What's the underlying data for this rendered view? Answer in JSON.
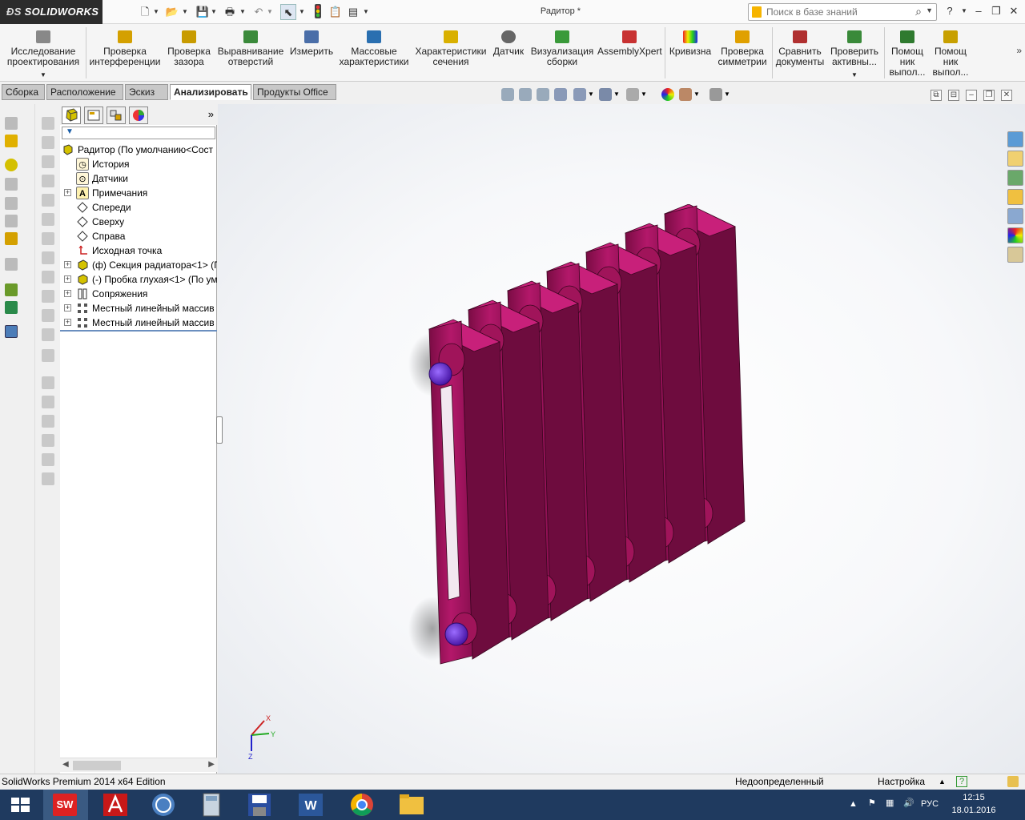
{
  "titlebar": {
    "app_name": "SOLIDWORKS",
    "doc_title": "Радитор *",
    "search_placeholder": "Поиск в базе знаний",
    "help": "?",
    "win_min": "‒",
    "win_max": "❐",
    "win_close": "✕"
  },
  "ribbon": {
    "buttons": [
      {
        "label": "Исследование проектирования",
        "icon": "design-study-icon"
      },
      {
        "label": "Проверка интерференции",
        "icon": "interference-icon"
      },
      {
        "label": "Проверка зазора",
        "icon": "clearance-icon"
      },
      {
        "label": "Выравнивание отверстий",
        "icon": "hole-align-icon"
      },
      {
        "label": "Измерить",
        "icon": "measure-icon"
      },
      {
        "label": "Массовые характеристики",
        "icon": "mass-props-icon"
      },
      {
        "label": "Характеристики сечения",
        "icon": "section-props-icon"
      },
      {
        "label": "Датчик",
        "icon": "sensor-icon"
      },
      {
        "label": "Визуализация сборки",
        "icon": "assembly-viz-icon"
      },
      {
        "label": "AssemblyXpert",
        "icon": "assemblyxpert-icon"
      },
      {
        "label": "Кривизна",
        "icon": "curvature-icon"
      },
      {
        "label": "Проверка симметрии",
        "icon": "symmetry-icon"
      },
      {
        "label": "Сравнить документы",
        "icon": "compare-icon"
      },
      {
        "label": "Проверить активны...",
        "icon": "check-active-icon"
      },
      {
        "label": "Помощ ник выпол...",
        "icon": "assistant-icon"
      },
      {
        "label": "Помощ ник выпол...",
        "icon": "assistant2-icon"
      }
    ]
  },
  "tabs": [
    {
      "label": "Сборка"
    },
    {
      "label": "Расположение"
    },
    {
      "label": "Эскиз"
    },
    {
      "label": "Анализировать"
    },
    {
      "label": "Продукты Office"
    }
  ],
  "featuretree": {
    "filter": "▼",
    "items": [
      {
        "label": "Радитор  (По умолчанию<Сост",
        "icon": "assembly-icon"
      },
      {
        "label": "История",
        "icon": "history-icon"
      },
      {
        "label": "Датчики",
        "icon": "sensors-icon"
      },
      {
        "label": "Примечания",
        "icon": "annotations-icon"
      },
      {
        "label": "Спереди",
        "icon": "plane-icon"
      },
      {
        "label": "Сверху",
        "icon": "plane-icon"
      },
      {
        "label": "Справа",
        "icon": "plane-icon"
      },
      {
        "label": "Исходная точка",
        "icon": "origin-icon"
      },
      {
        "label": "(ф) Секция радиатора<1> (П",
        "icon": "part-icon"
      },
      {
        "label": "(-) Пробка глухая<1> (По ум",
        "icon": "part-icon"
      },
      {
        "label": "Сопряжения",
        "icon": "mates-icon"
      },
      {
        "label": "Местный линейный массив",
        "icon": "pattern-icon"
      },
      {
        "label": "Местный линейный массив",
        "icon": "pattern-icon"
      }
    ]
  },
  "triad": {
    "x": "X",
    "y": "Y",
    "z": "Z"
  },
  "status": {
    "edition": "SolidWorks Premium 2014 x64 Edition",
    "state": "Недоопределенный",
    "settings": "Настройка",
    "help": "?"
  },
  "tray": {
    "lang": "РУС",
    "time": "12:15",
    "date": "18.01.2016"
  },
  "colors": {
    "model": "#a0145a",
    "model_light": "#c8207a",
    "model_dark": "#6e0c3e",
    "plug": "#6a28d0"
  }
}
